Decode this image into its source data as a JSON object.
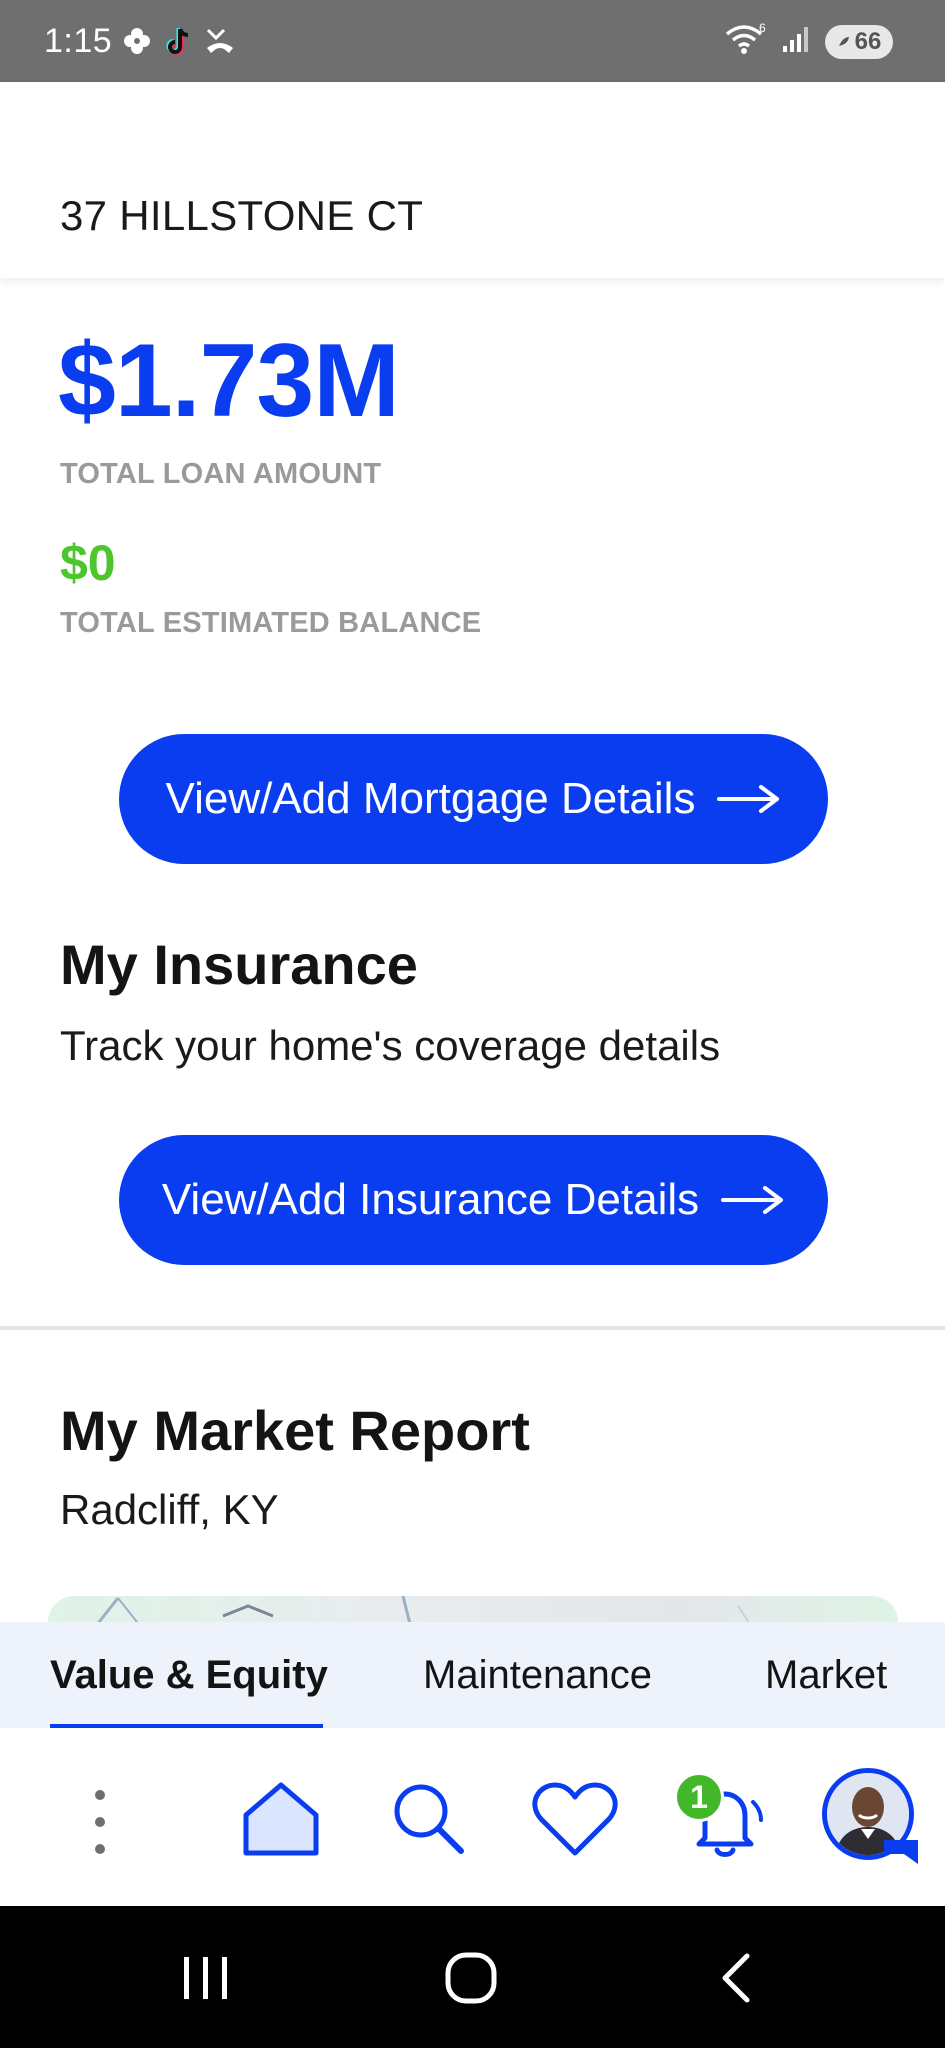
{
  "status_bar": {
    "time": "1:15",
    "battery": "66",
    "wifi_badge": "6",
    "left_icons": [
      "pinwheel-icon",
      "tiktok-icon",
      "missed-call-icon"
    ],
    "right_icons": [
      "wifi-icon",
      "signal-icon",
      "battery-icon"
    ]
  },
  "header": {
    "address": "37 HILLSTONE CT"
  },
  "mortgage": {
    "total_loan_amount": "$1.73M",
    "total_loan_label": "TOTAL LOAN AMOUNT",
    "total_balance": "$0",
    "total_balance_label": "TOTAL ESTIMATED BALANCE",
    "button_label": "View/Add Mortgage Details"
  },
  "insurance": {
    "title": "My Insurance",
    "subtitle": "Track your home's coverage details",
    "button_label": "View/Add Insurance Details"
  },
  "market_report": {
    "title": "My Market Report",
    "location": "Radcliff, KY"
  },
  "tabs": [
    {
      "label": "Value & Equity",
      "active": true
    },
    {
      "label": "Maintenance",
      "active": false
    },
    {
      "label": "Market",
      "active": false
    }
  ],
  "bottom_nav": {
    "items": [
      "more-icon",
      "home-icon",
      "search-icon",
      "heart-icon",
      "bell-icon",
      "avatar"
    ],
    "notification_count": "1"
  },
  "colors": {
    "accent": "#0a3df0",
    "balance_green": "#4cc62c",
    "caption_gray": "#9a9a9a",
    "tab_bar_bg": "#eef2fb"
  }
}
